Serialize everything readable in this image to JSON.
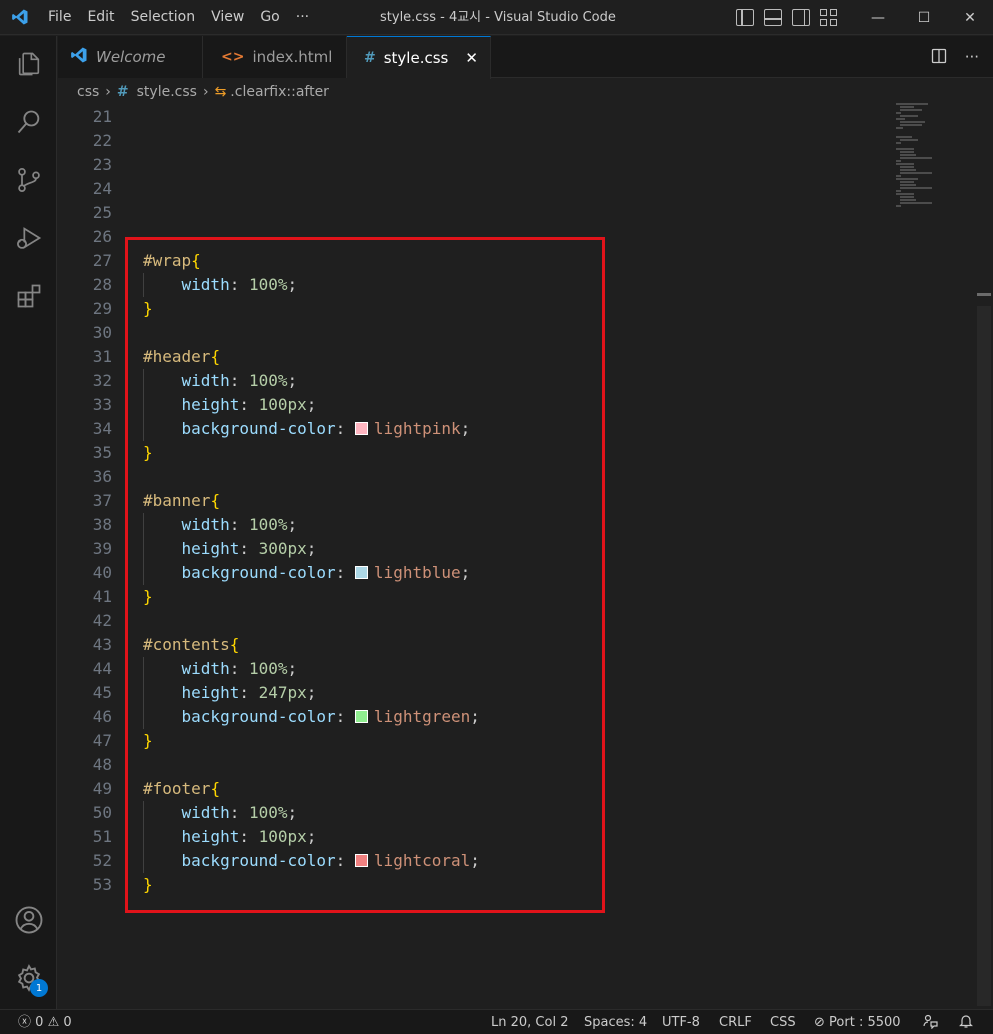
{
  "titlebar": {
    "menu": [
      "File",
      "Edit",
      "Selection",
      "View",
      "Go",
      "···"
    ],
    "title": "style.css - 4교시 - Visual Studio Code"
  },
  "tabs": [
    {
      "label": "Welcome",
      "icon": "vscode-icon"
    },
    {
      "label": "index.html",
      "icon": "html-icon"
    },
    {
      "label": "style.css",
      "icon": "css-hash-icon"
    }
  ],
  "breadcrumb": {
    "folder": "css",
    "file": "style.css",
    "symbol": ".clearfix::after"
  },
  "editor": {
    "empty_lines": [
      "21",
      "22",
      "23",
      "24",
      "25",
      "26"
    ],
    "blocks": [
      {
        "selector": "#wrap",
        "start": "27",
        "end": "29",
        "decls": [
          {
            "ln": "28",
            "prop": "width",
            "value": "100%",
            "type": "num"
          }
        ]
      },
      {
        "gap": "30"
      },
      {
        "selector": "#header",
        "start": "31",
        "end": "35",
        "decls": [
          {
            "ln": "32",
            "prop": "width",
            "value": "100%",
            "type": "num"
          },
          {
            "ln": "33",
            "prop": "height",
            "value": "100px",
            "type": "num"
          },
          {
            "ln": "34",
            "prop": "background-color",
            "value": "lightpink",
            "type": "color",
            "swatch": "#ffb6c1"
          }
        ]
      },
      {
        "gap": "36"
      },
      {
        "selector": "#banner",
        "start": "37",
        "end": "41",
        "decls": [
          {
            "ln": "38",
            "prop": "width",
            "value": "100%",
            "type": "num"
          },
          {
            "ln": "39",
            "prop": "height",
            "value": "300px",
            "type": "num"
          },
          {
            "ln": "40",
            "prop": "background-color",
            "value": "lightblue",
            "type": "color",
            "swatch": "#add8e6"
          }
        ]
      },
      {
        "gap": "42"
      },
      {
        "selector": "#contents",
        "start": "43",
        "end": "47",
        "decls": [
          {
            "ln": "44",
            "prop": "width",
            "value": "100%",
            "type": "num"
          },
          {
            "ln": "45",
            "prop": "height",
            "value": "247px",
            "type": "num"
          },
          {
            "ln": "46",
            "prop": "background-color",
            "value": "lightgreen",
            "type": "color",
            "swatch": "#90ee90"
          }
        ]
      },
      {
        "gap": "48"
      },
      {
        "selector": "#footer",
        "start": "49",
        "end": "53",
        "decls": [
          {
            "ln": "50",
            "prop": "width",
            "value": "100%",
            "type": "num"
          },
          {
            "ln": "51",
            "prop": "height",
            "value": "100px",
            "type": "num"
          },
          {
            "ln": "52",
            "prop": "background-color",
            "value": "lightcoral",
            "type": "color",
            "swatch": "#f08080"
          }
        ]
      }
    ]
  },
  "activitybar": {
    "icons": [
      "explorer-icon",
      "search-icon",
      "source-control-icon",
      "run-debug-icon",
      "extensions-icon",
      "account-icon",
      "settings-gear-icon"
    ],
    "settings_badge": "1"
  },
  "statusbar": {
    "errors": "0",
    "warnings": "0",
    "position": "Ln 20, Col 2",
    "spaces": "Spaces: 4",
    "encoding": "UTF-8",
    "eol": "CRLF",
    "language": "CSS",
    "port": "Port : 5500"
  },
  "colors": {
    "accent": "#0078d4",
    "highlight_box": "#e0131a"
  }
}
